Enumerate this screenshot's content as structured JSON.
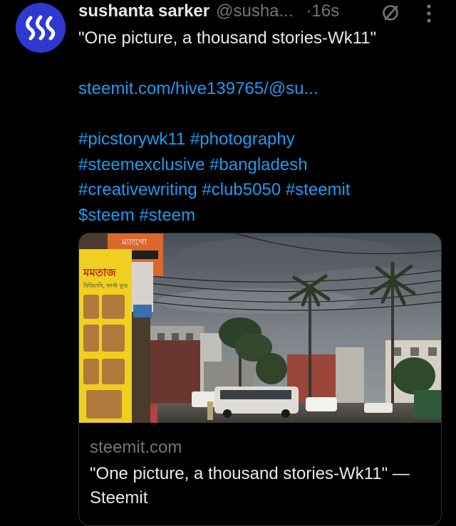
{
  "tweet": {
    "author": {
      "display_name": "sushanta sarker",
      "handle": "@susha..."
    },
    "separator": "·",
    "timestamp": "16s",
    "text_line_1": "\"One picture, a thousand stories-Wk11\"",
    "link": "steemit.com/hive139765/@su...",
    "hashtags": [
      "#picstorywk11 #photography",
      "#steemexclusive #bangladesh",
      "#creativewriting #club5050 #steemit",
      "$steem #steem"
    ]
  },
  "card": {
    "domain": "steemit.com",
    "title": "\"One picture, a thousand stories-Wk11\" — Steemit",
    "sign_top": "ম্যাংগো",
    "sign_main": "মমতাজ",
    "sign_sub": "বিরিয়ানি, ফাস্ট ফুড"
  },
  "icons": {
    "avatar": "steem-logo-icon",
    "status": "no-entry-icon",
    "menu": "more-vertical-icon"
  },
  "colors": {
    "background": "#000000",
    "text": "#e7e9ea",
    "muted": "#71767b",
    "link": "#1d9bf0",
    "avatar": "#2f39cf",
    "border": "#2f3336"
  }
}
